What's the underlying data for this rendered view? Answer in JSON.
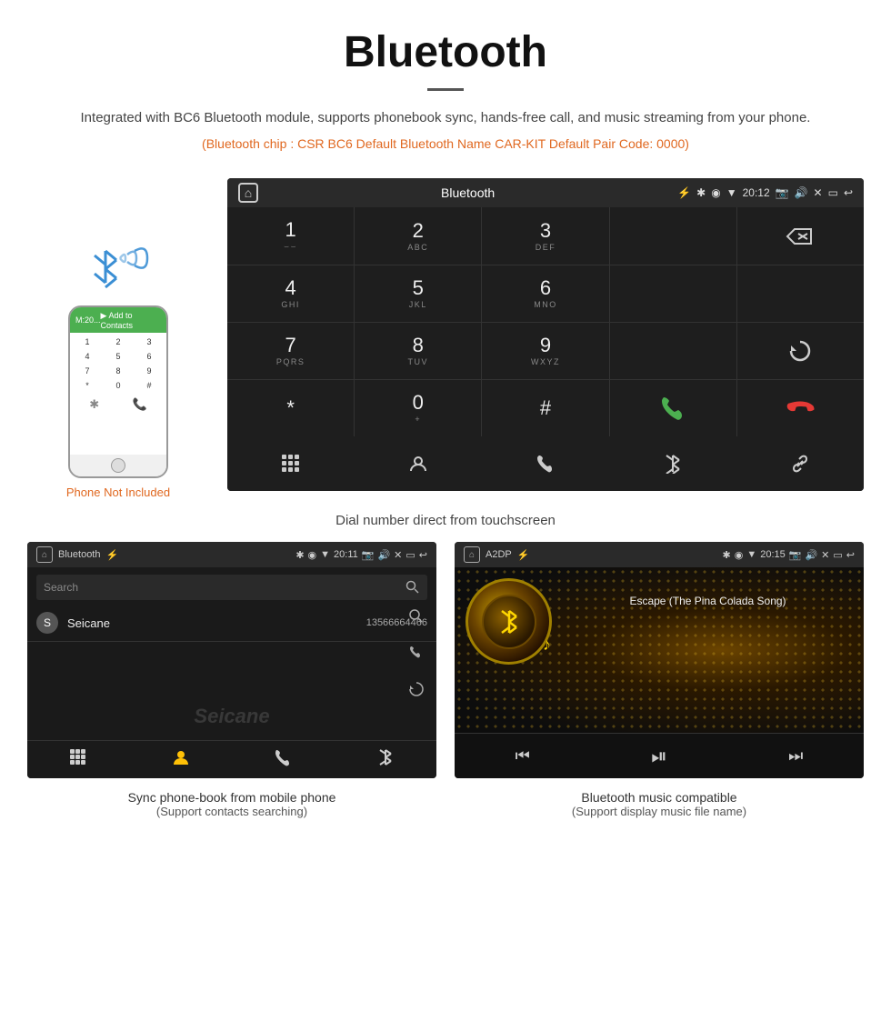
{
  "header": {
    "title": "Bluetooth",
    "description": "Integrated with BC6 Bluetooth module, supports phonebook sync, hands-free call, and music streaming from your phone.",
    "specs": "(Bluetooth chip : CSR BC6    Default Bluetooth Name CAR-KIT    Default Pair Code: 0000)"
  },
  "dial_screen": {
    "status_bar": {
      "app_name": "Bluetooth",
      "time": "20:12",
      "icons": [
        "home",
        "bluetooth",
        "usb",
        "location",
        "wifi",
        "camera",
        "volume",
        "close",
        "window",
        "back"
      ]
    },
    "keys": [
      {
        "num": "1",
        "alpha": "⌣⌣"
      },
      {
        "num": "2",
        "alpha": "ABC"
      },
      {
        "num": "3",
        "alpha": "DEF"
      },
      {
        "num": "",
        "alpha": ""
      },
      {
        "num": "⌫",
        "alpha": ""
      },
      {
        "num": "4",
        "alpha": "GHI"
      },
      {
        "num": "5",
        "alpha": "JKL"
      },
      {
        "num": "6",
        "alpha": "MNO"
      },
      {
        "num": "",
        "alpha": ""
      },
      {
        "num": "",
        "alpha": ""
      },
      {
        "num": "7",
        "alpha": "PQRS"
      },
      {
        "num": "8",
        "alpha": "TUV"
      },
      {
        "num": "9",
        "alpha": "WXYZ"
      },
      {
        "num": "",
        "alpha": ""
      },
      {
        "num": "↺",
        "alpha": ""
      },
      {
        "num": "*",
        "alpha": ""
      },
      {
        "num": "0",
        "alpha": "+"
      },
      {
        "num": "#",
        "alpha": ""
      },
      {
        "num": "📞",
        "alpha": "call"
      },
      {
        "num": "📵",
        "alpha": "end"
      }
    ],
    "bottom_icons": [
      "grid",
      "person",
      "phone",
      "bluetooth",
      "link"
    ]
  },
  "phone_label": "Phone Not Included",
  "main_caption": "Dial number direct from touchscreen",
  "phonebook_screen": {
    "status_bar": {
      "app_name": "Bluetooth",
      "time": "20:11"
    },
    "search_placeholder": "Search",
    "contact": {
      "letter": "S",
      "name": "Seicane",
      "number": "13566664466"
    },
    "bottom_icons": [
      "grid",
      "person",
      "phone",
      "bluetooth"
    ]
  },
  "music_screen": {
    "status_bar": {
      "app_name": "A2DP",
      "time": "20:15"
    },
    "song_title": "Escape (The Pina Colada Song)",
    "controls": [
      "prev",
      "play-pause",
      "next"
    ]
  },
  "bottom_captions": [
    {
      "main": "Sync phone-book from mobile phone",
      "sub": "(Support contacts searching)"
    },
    {
      "main": "Bluetooth music compatible",
      "sub": "(Support display music file name)"
    }
  ]
}
